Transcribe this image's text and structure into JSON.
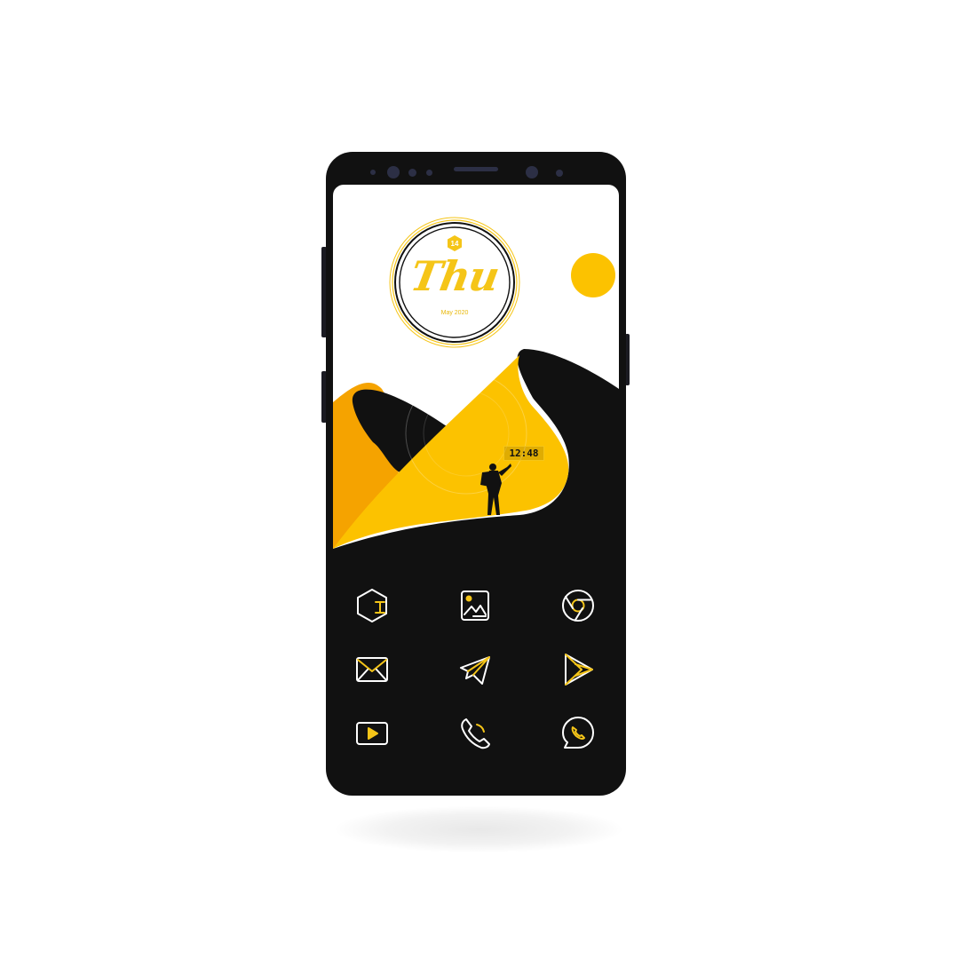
{
  "widget": {
    "date_number": "14",
    "day": "Thu",
    "month_year": "May 2020"
  },
  "clock": {
    "time": "12:48"
  },
  "colors": {
    "accent": "#f5c518",
    "accent_dark": "#f0a000",
    "background_dark": "#111111",
    "icon_stroke": "#ffffff"
  },
  "dock_icons": [
    "launcher-icon",
    "gallery-icon",
    "chrome-icon",
    "mail-icon",
    "telegram-icon",
    "play-store-icon",
    "youtube-icon",
    "phone-icon",
    "whatsapp-icon"
  ]
}
